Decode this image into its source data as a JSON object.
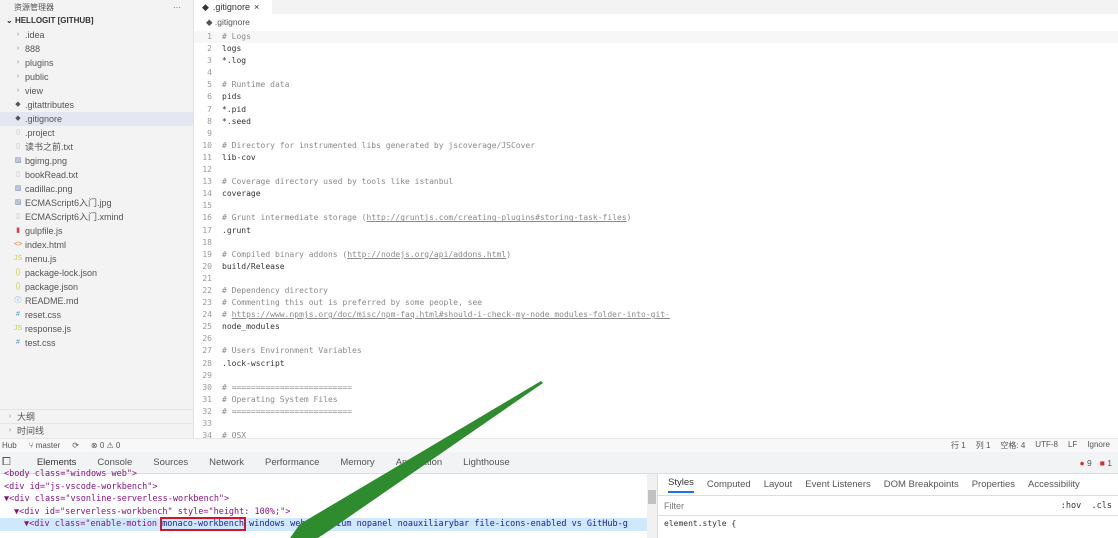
{
  "sidebar": {
    "title": "资源管理器",
    "more": "···",
    "root": "HELLOGIT [GITHUB]",
    "items": [
      {
        "label": ".idea",
        "icon": "chevron-right"
      },
      {
        "label": "888",
        "icon": "chevron-right"
      },
      {
        "label": "plugins",
        "icon": "chevron-right"
      },
      {
        "label": "public",
        "icon": "chevron-right"
      },
      {
        "label": "view",
        "icon": "chevron-right"
      },
      {
        "label": ".gitattributes",
        "icon": "git"
      },
      {
        "label": ".gitignore",
        "icon": "git",
        "selected": true
      },
      {
        "label": ".project",
        "icon": "file"
      },
      {
        "label": "读书之前.txt",
        "icon": "file"
      },
      {
        "label": "bgimg.png",
        "icon": "image"
      },
      {
        "label": "bookRead.txt",
        "icon": "file"
      },
      {
        "label": "cadillac.png",
        "icon": "image"
      },
      {
        "label": "ECMAScript6入门.jpg",
        "icon": "image"
      },
      {
        "label": "ECMAScript6入门.xmind",
        "icon": "file"
      },
      {
        "label": "gulpfile.js",
        "icon": "gulp"
      },
      {
        "label": "index.html",
        "icon": "html"
      },
      {
        "label": "menu.js",
        "icon": "js"
      },
      {
        "label": "package-lock.json",
        "icon": "json"
      },
      {
        "label": "package.json",
        "icon": "json"
      },
      {
        "label": "README.md",
        "icon": "info"
      },
      {
        "label": "reset.css",
        "icon": "css"
      },
      {
        "label": "response.js",
        "icon": "js"
      },
      {
        "label": "test.css",
        "icon": "css"
      }
    ],
    "bottom": [
      "大纲",
      "时间线"
    ]
  },
  "tab": {
    "label": ".gitignore",
    "close": "×"
  },
  "breadcrumb": ".gitignore",
  "code": [
    [
      "# Logs",
      "cm"
    ],
    [
      "logs",
      ""
    ],
    [
      "*.log",
      ""
    ],
    [
      "",
      ""
    ],
    [
      "# Runtime data",
      "cm"
    ],
    [
      "pids",
      ""
    ],
    [
      "*.pid",
      ""
    ],
    [
      "*.seed",
      ""
    ],
    [
      "",
      ""
    ],
    [
      "# Directory for instrumented libs generated by jscoverage/JSCover",
      "cm"
    ],
    [
      "lib-cov",
      ""
    ],
    [
      "",
      ""
    ],
    [
      "# Coverage directory used by tools like istanbul",
      "cm"
    ],
    [
      "coverage",
      ""
    ],
    [
      "",
      ""
    ],
    [
      "# Grunt intermediate storage (http://gruntjs.com/creating-plugins#storing-task-files)",
      "cm"
    ],
    [
      ".grunt",
      ""
    ],
    [
      "",
      ""
    ],
    [
      "# Compiled binary addons (http://nodejs.org/api/addons.html)",
      "cm"
    ],
    [
      "build/Release",
      ""
    ],
    [
      "",
      ""
    ],
    [
      "# Dependency directory",
      "cm"
    ],
    [
      "# Commenting this out is preferred by some people, see",
      "cm"
    ],
    [
      "# https://www.npmjs.org/doc/misc/npm-faq.html#should-i-check-my-node_modules-folder-into-git-",
      "cm"
    ],
    [
      "node_modules",
      ""
    ],
    [
      "",
      ""
    ],
    [
      "# Users Environment Variables",
      "cm"
    ],
    [
      ".lock-wscript",
      ""
    ],
    [
      "",
      ""
    ],
    [
      "# =========================",
      "cm"
    ],
    [
      "# Operating System Files",
      "cm"
    ],
    [
      "# =========================",
      "cm"
    ],
    [
      "",
      ""
    ],
    [
      "# OSX",
      "cm"
    ]
  ],
  "status": {
    "left": "Hub",
    "branch": "master",
    "sync": "⟳",
    "problems": "⊗ 0 ⚠ 0",
    "right": [
      "行 1",
      "列 1",
      "空格: 4",
      "UTF-8",
      "LF",
      "Ignore"
    ]
  },
  "devtools": {
    "tabs": [
      "Elements",
      "Console",
      "Sources",
      "Network",
      "Performance",
      "Memory",
      "Application",
      "Lighthouse"
    ],
    "errors": "9",
    "warnings": "1",
    "dom": [
      "<body class=\"windows web\">",
      "<div id=\"js-vscode-workbench\">",
      "▼<div class=\"vsonline-serverless-workbench\">",
      "▼<div id=\"serverless-workbench\" style=\"height: 100%;\">"
    ],
    "selected": {
      "pre": "▼<div class=\"enable-motion ",
      "hl": "monaco-workbench",
      "post": " windows web chromium nopanel noauxiliarybar file-icons-enabled vs GitHub-g"
    },
    "styles_tabs": [
      "Styles",
      "Computed",
      "Layout",
      "Event Listeners",
      "DOM Breakpoints",
      "Properties",
      "Accessibility"
    ],
    "filter_placeholder": "Filter",
    "hov": ":hov",
    "cls": ".cls",
    "element_style": "element.style {"
  },
  "colors": {
    "arrow": "#2e8b2e",
    "highlight": "#d0162c",
    "accent": "#1a73e8"
  }
}
